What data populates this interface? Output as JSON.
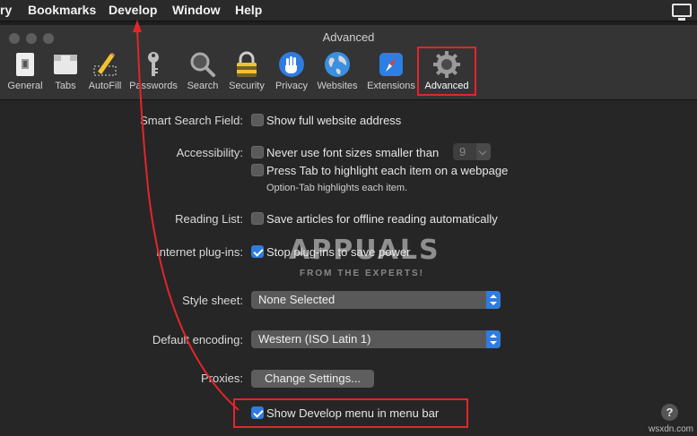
{
  "menubar": {
    "items": [
      "ry",
      "Bookmarks",
      "Develop",
      "Window",
      "Help"
    ]
  },
  "window": {
    "title": "Advanced"
  },
  "toolbar": {
    "items": [
      {
        "label": "General",
        "icon": "general-icon"
      },
      {
        "label": "Tabs",
        "icon": "tabs-icon"
      },
      {
        "label": "AutoFill",
        "icon": "autofill-icon"
      },
      {
        "label": "Passwords",
        "icon": "key-icon"
      },
      {
        "label": "Search",
        "icon": "magnifier-icon"
      },
      {
        "label": "Security",
        "icon": "lock-icon"
      },
      {
        "label": "Privacy",
        "icon": "hand-icon"
      },
      {
        "label": "Websites",
        "icon": "globe-icon"
      },
      {
        "label": "Extensions",
        "icon": "compass-icon"
      },
      {
        "label": "Advanced",
        "icon": "gear-icon"
      }
    ],
    "selected": "Advanced"
  },
  "settings": {
    "smart_search": {
      "label": "Smart Search Field:",
      "option": "Show full website address",
      "checked": false
    },
    "accessibility": {
      "label": "Accessibility:",
      "font_option": "Never use font sizes smaller than",
      "font_value": "9",
      "tab_option": "Press Tab to highlight each item on a webpage",
      "tab_hint": "Option-Tab highlights each item."
    },
    "reading_list": {
      "label": "Reading List:",
      "option": "Save articles for offline reading automatically"
    },
    "plugins": {
      "label": "Internet plug-ins:",
      "option": "Stop plug-ins to save power",
      "checked": true
    },
    "style_sheet": {
      "label": "Style sheet:",
      "value": "None Selected"
    },
    "encoding": {
      "label": "Default encoding:",
      "value": "Western (ISO Latin 1)"
    },
    "proxies": {
      "label": "Proxies:",
      "button": "Change Settings..."
    },
    "develop": {
      "option": "Show Develop menu in menu bar",
      "checked": true
    }
  },
  "help_button": "?",
  "watermark": {
    "main": "APPUALS",
    "sub": "FROM THE EXPERTS!"
  },
  "footer": "wsxdn.com",
  "colors": {
    "accent": "#2f7ce0",
    "highlight": "#e2262b"
  }
}
